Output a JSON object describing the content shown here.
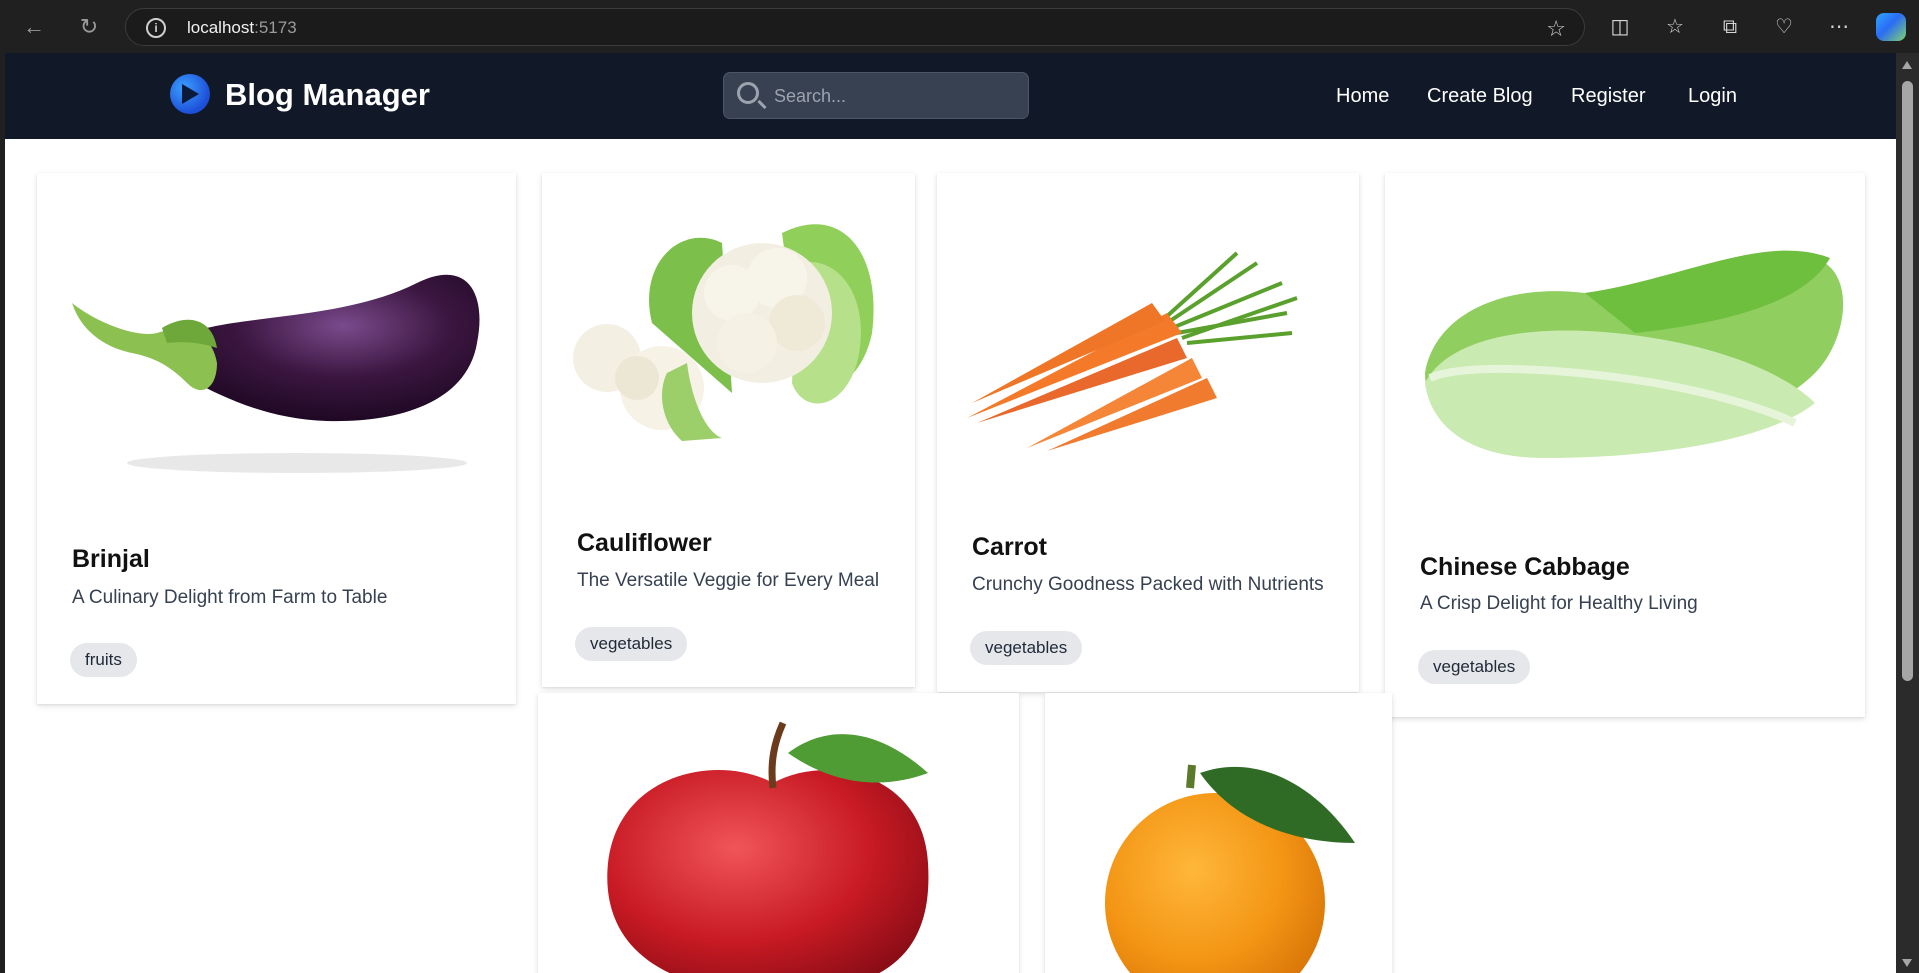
{
  "browser": {
    "url_host": "localhost",
    "url_port": ":5173",
    "back_icon": "back-arrow-icon",
    "reload_icon": "reload-icon"
  },
  "site": {
    "brand": "Blog Manager",
    "search_placeholder": "Search...",
    "nav": [
      "Home",
      "Create Blog",
      "Register",
      "Login"
    ]
  },
  "cards": [
    {
      "title": "Brinjal",
      "description": "A Culinary Delight from Farm to Table",
      "tag": "fruits",
      "image": "eggplant"
    },
    {
      "title": "Cauliflower",
      "description": "The Versatile Veggie for Every Meal",
      "tag": "vegetables",
      "image": "cauliflower"
    },
    {
      "title": "Carrot",
      "description": "Crunchy Goodness Packed with Nutrients",
      "tag": "vegetables",
      "image": "carrots"
    },
    {
      "title": "Chinese Cabbage",
      "description": "A Crisp Delight for Healthy Living",
      "tag": "vegetables",
      "image": "bok-choy"
    },
    {
      "title": "",
      "description": "",
      "tag": "",
      "image": "apple"
    },
    {
      "title": "",
      "description": "",
      "tag": "",
      "image": "orange"
    }
  ],
  "colors": {
    "header_bg": "#111827",
    "tag_bg": "#e5e7eb",
    "search_bg": "#374151"
  }
}
